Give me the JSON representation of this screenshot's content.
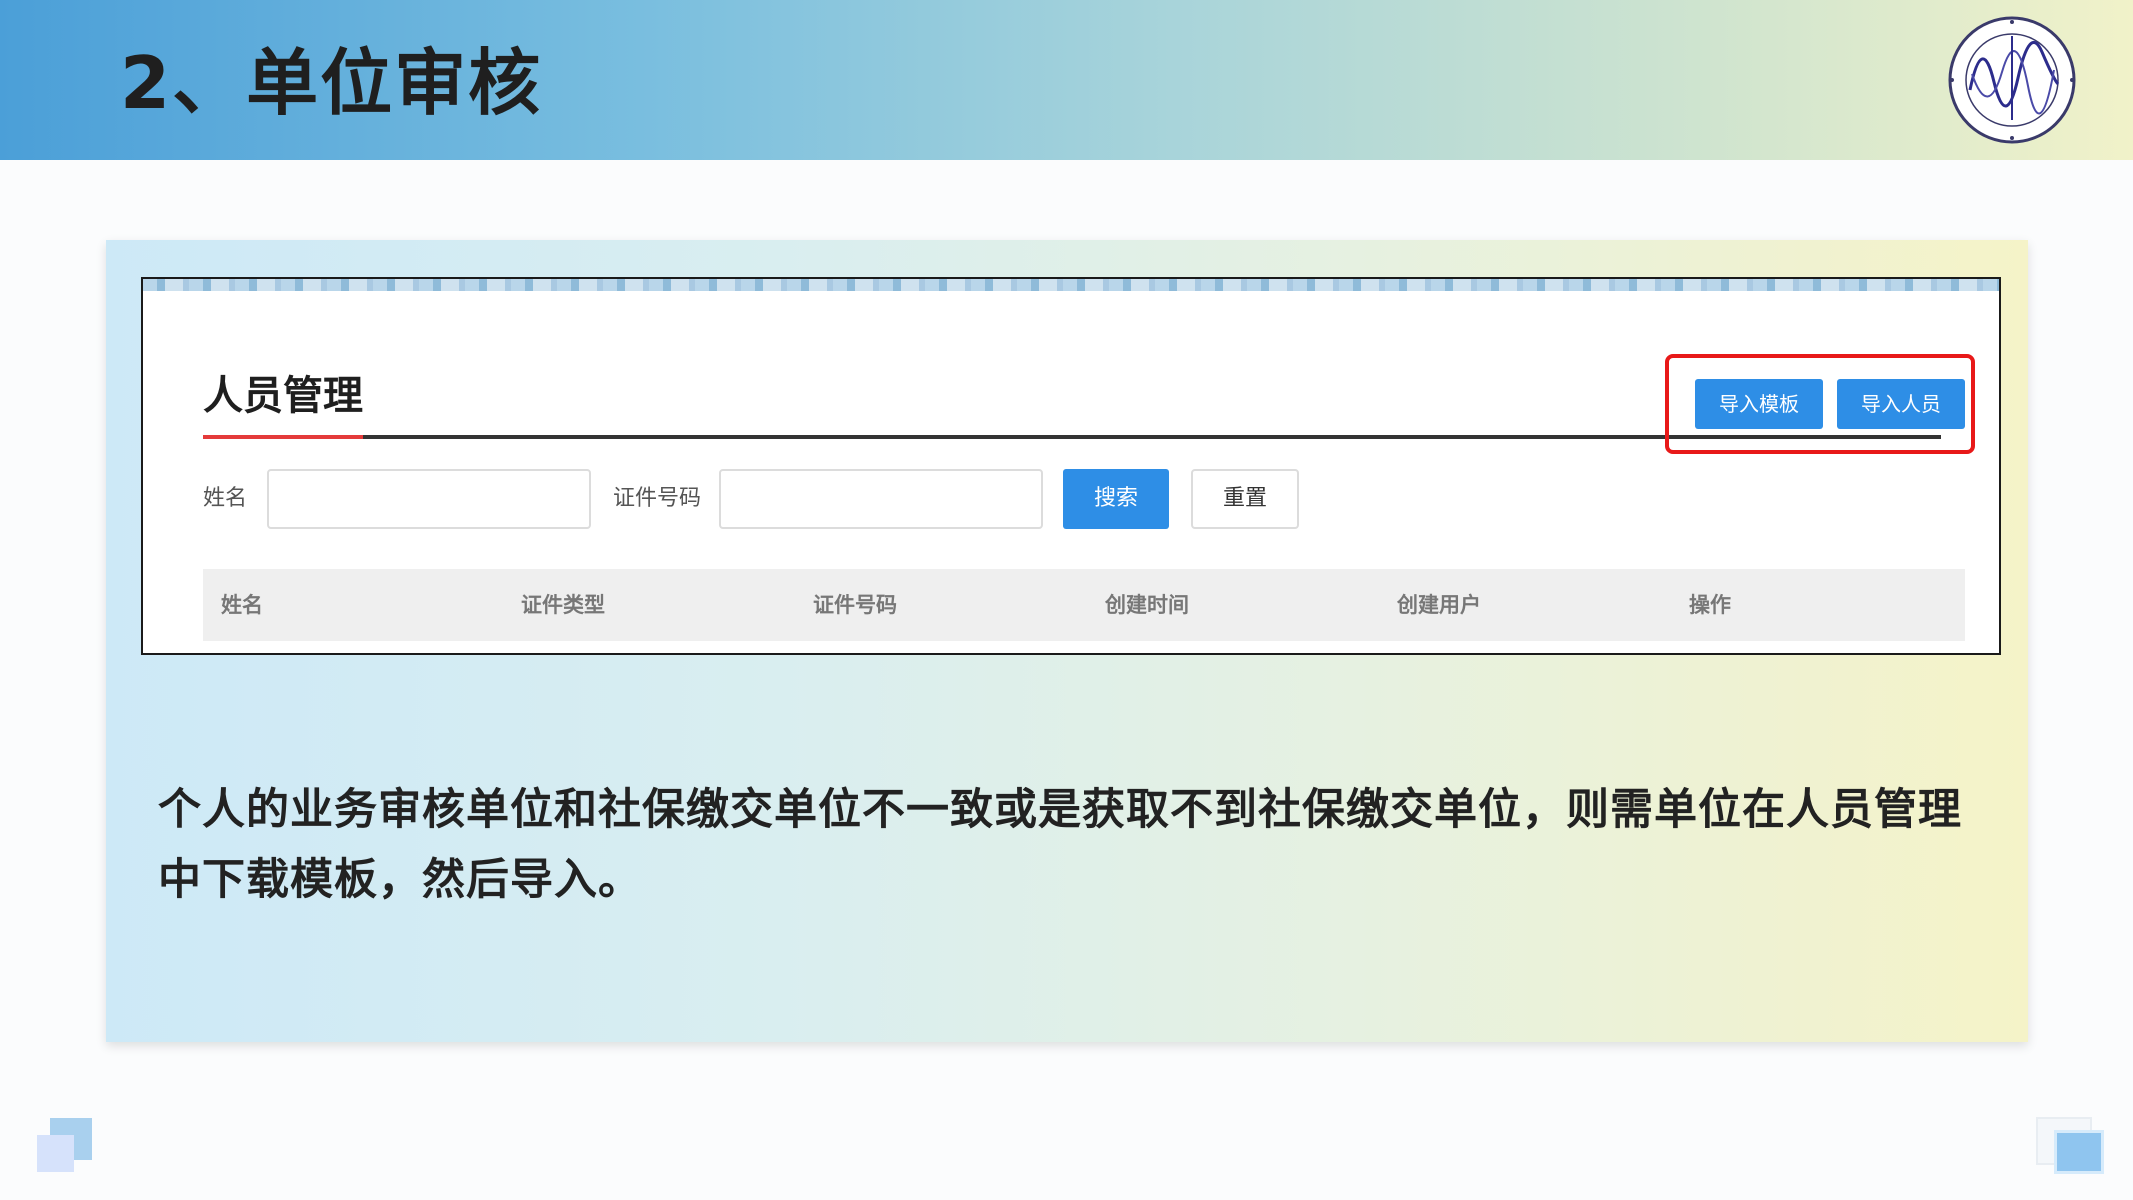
{
  "slide": {
    "title": "2、单位审核"
  },
  "screenshot": {
    "section_title": "人员管理",
    "buttons": {
      "import_template": "导入模板",
      "import_personnel": "导入人员",
      "search": "搜索",
      "reset": "重置"
    },
    "filters": {
      "name_label": "姓名",
      "name_value": "",
      "id_label": "证件号码",
      "id_value": ""
    },
    "table_columns": [
      "姓名",
      "证件类型",
      "证件号码",
      "创建时间",
      "创建用户",
      "操作"
    ]
  },
  "description": "个人的业务审核单位和社保缴交单位不一致或是获取不到社保缴交单位，则需单位在人员管理中下载模板，然后导入。",
  "colors": {
    "accent_blue": "#2e8ee6",
    "highlight_red": "#e81919",
    "title_accent_red": "#e43a3a"
  },
  "icons": {
    "logo": "sata-logo-icon"
  }
}
